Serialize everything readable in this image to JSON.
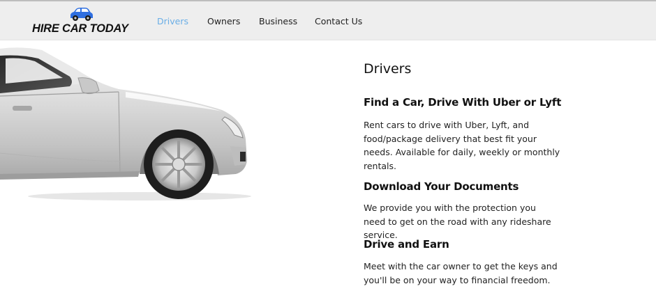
{
  "header": {
    "logo_text": "HIRE CAR TODAY",
    "nav": [
      {
        "label": "Drivers",
        "active": true
      },
      {
        "label": "Owners",
        "active": false
      },
      {
        "label": "Business",
        "active": false
      },
      {
        "label": "Contact Us",
        "active": false
      }
    ]
  },
  "main": {
    "page_title": "Drivers",
    "sections": [
      {
        "heading": "Find a Car, Drive With Uber or Lyft",
        "body": "Rent cars to drive with Uber, Lyft, and food/package delivery that best fit your needs. Available for daily, weekly or monthly rentals."
      },
      {
        "heading": "Download Your Documents",
        "body": "We provide you with the protection you need to get on the road with any rideshare service."
      },
      {
        "heading": "Drive and Earn",
        "body": "Meet with the car owner to get the keys and you'll be on your way to financial freedom."
      }
    ]
  },
  "colors": {
    "header_bg": "#eeeeee",
    "nav_active": "#6aaee6",
    "logo_car": "#2f6fe0",
    "text": "#111111"
  },
  "icons": {
    "logo": "blue-car-icon",
    "hero": "silver-sedan-image"
  }
}
